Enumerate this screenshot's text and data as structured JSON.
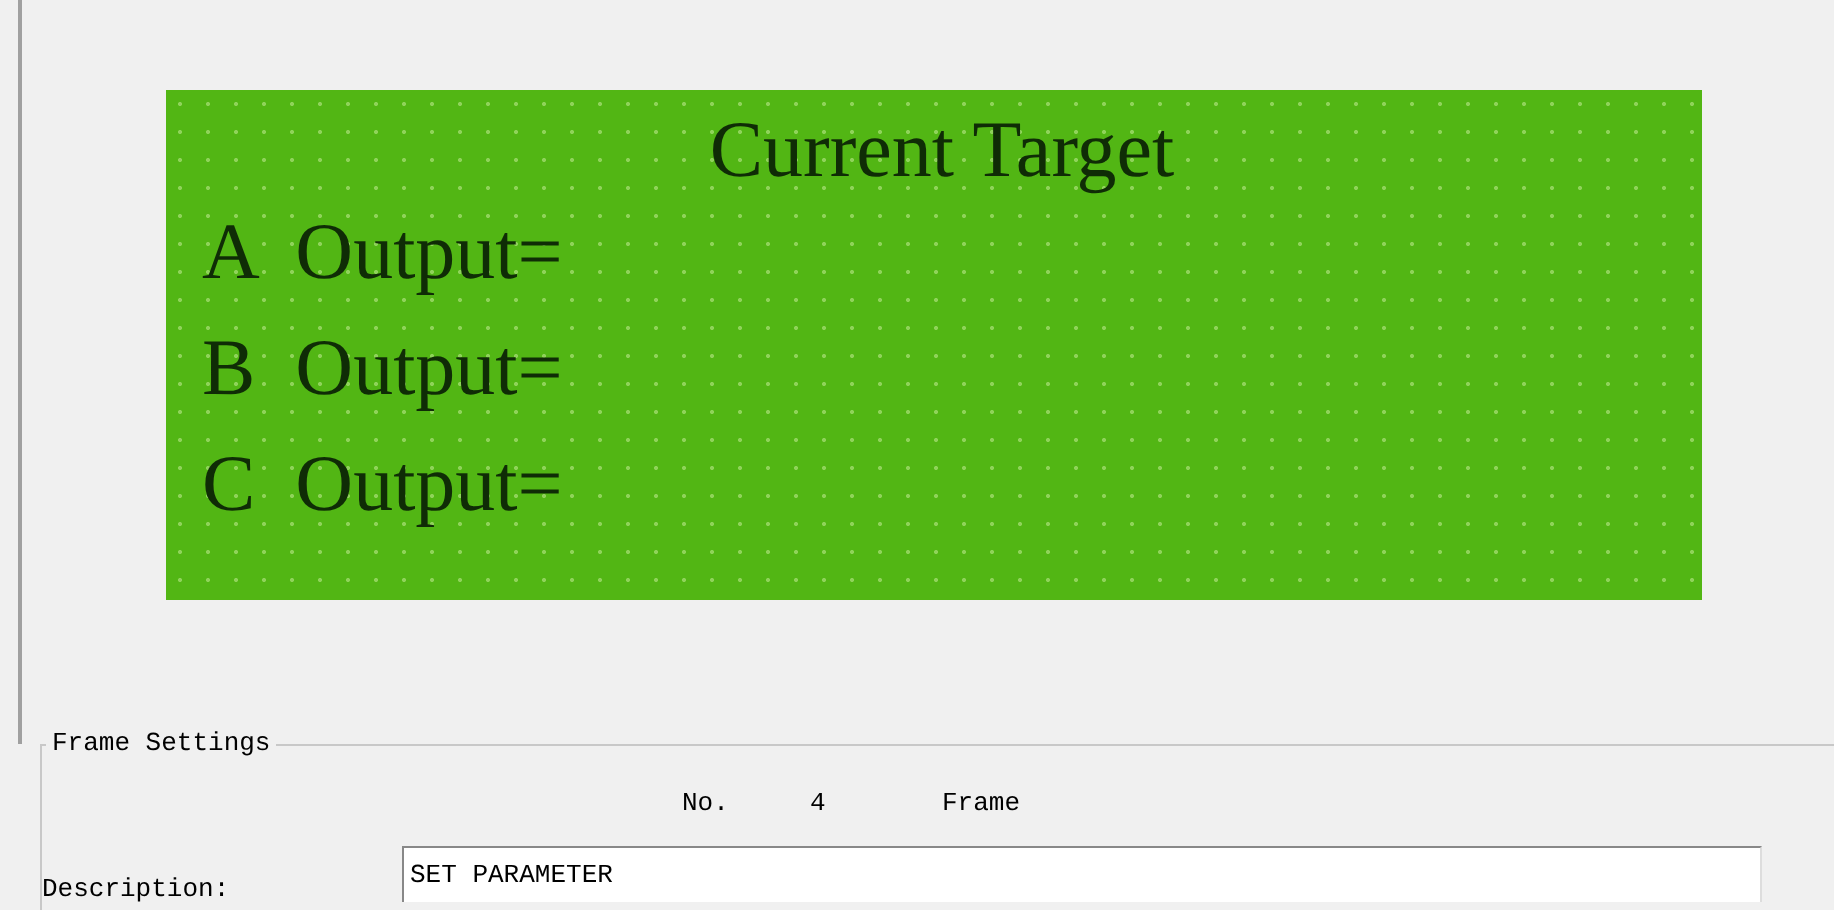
{
  "display": {
    "title": "Current Target",
    "lines": [
      "A  Output=",
      "B  Output=",
      "C  Output="
    ]
  },
  "frame_settings": {
    "title": "Frame Settings",
    "number_label": "No.",
    "number": "4",
    "number_unit": "Frame",
    "description_label": "Description:",
    "description": "SET PARAMETER"
  }
}
